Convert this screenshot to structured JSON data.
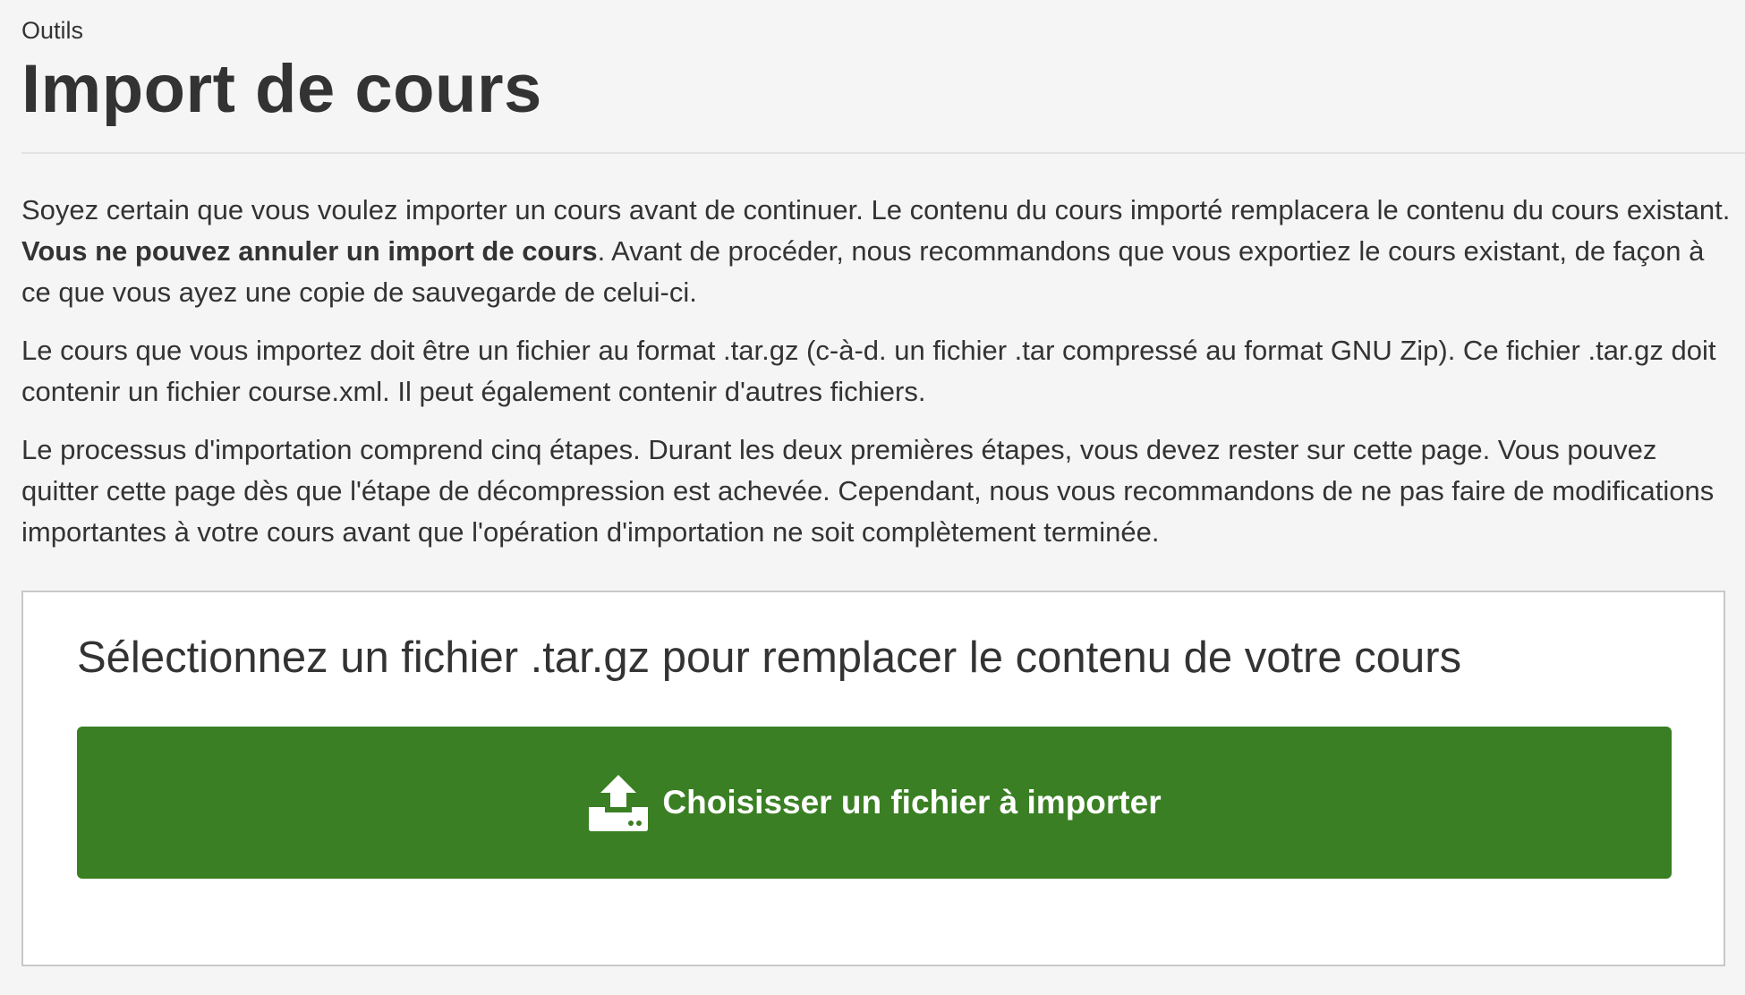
{
  "header": {
    "breadcrumb": "Outils",
    "title": "Import de cours"
  },
  "intro": {
    "p1_part1": "Soyez certain que vous voulez importer un cours avant de continuer. Le contenu du cours importé remplacera le contenu du cours existant. ",
    "p1_bold": "Vous ne pouvez annuler un import de cours",
    "p1_part2": ". Avant de procéder, nous recommandons que vous exportiez le cours existant, de façon à ce que vous ayez une copie de sauvegarde de celui-ci.",
    "p2": "Le cours que vous importez doit être un fichier au format .tar.gz (c-à-d. un fichier .tar compressé au format GNU Zip). Ce fichier .tar.gz doit contenir un fichier course.xml. Il peut également contenir d'autres fichiers.",
    "p3": "Le processus d'importation comprend cinq étapes. Durant les deux premières étapes, vous devez rester sur cette page. Vous pouvez quitter cette page dès que l'étape de décompression est achevée. Cependant, nous vous recommandons de ne pas faire de modifications importantes à votre cours avant que l'opération d'importation ne soit complètement terminée."
  },
  "upload": {
    "heading": "Sélectionnez un fichier .tar.gz pour remplacer le contenu de votre cours",
    "button_label": "Choisisser un fichier à importer",
    "button_icon": "upload-icon"
  },
  "colors": {
    "background": "#f5f5f5",
    "panel": "#ffffff",
    "button": "#3a7f23",
    "text": "#333333"
  }
}
